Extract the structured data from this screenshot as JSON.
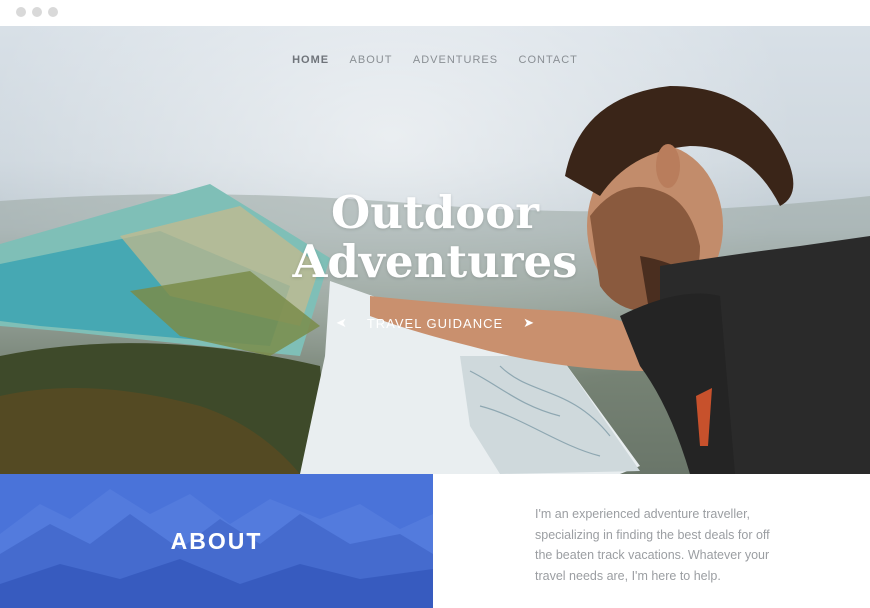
{
  "browser": {
    "dots": [
      "dot-1",
      "dot-2",
      "dot-3"
    ]
  },
  "nav": {
    "items": [
      "HOME",
      "ABOUT",
      "ADVENTURES",
      "CONTACT"
    ],
    "active": "HOME"
  },
  "hero": {
    "title_line1": "Outdoor",
    "title_line2": "Adventures",
    "tagline": "TRAVEL GUIDANCE",
    "arrow_left_icon": "arrow-left-icon",
    "arrow_right_icon": "arrow-right-icon"
  },
  "about": {
    "heading": "ABOUT",
    "text": "I'm an experienced adventure traveller, specializing in finding the best deals for off the beaten track vacations. Whatever your travel needs are, I'm here to help."
  },
  "colors": {
    "about_panel": "#4a73d9",
    "nav_text": "#8a8f94",
    "body_text": "#9b9ea2"
  }
}
